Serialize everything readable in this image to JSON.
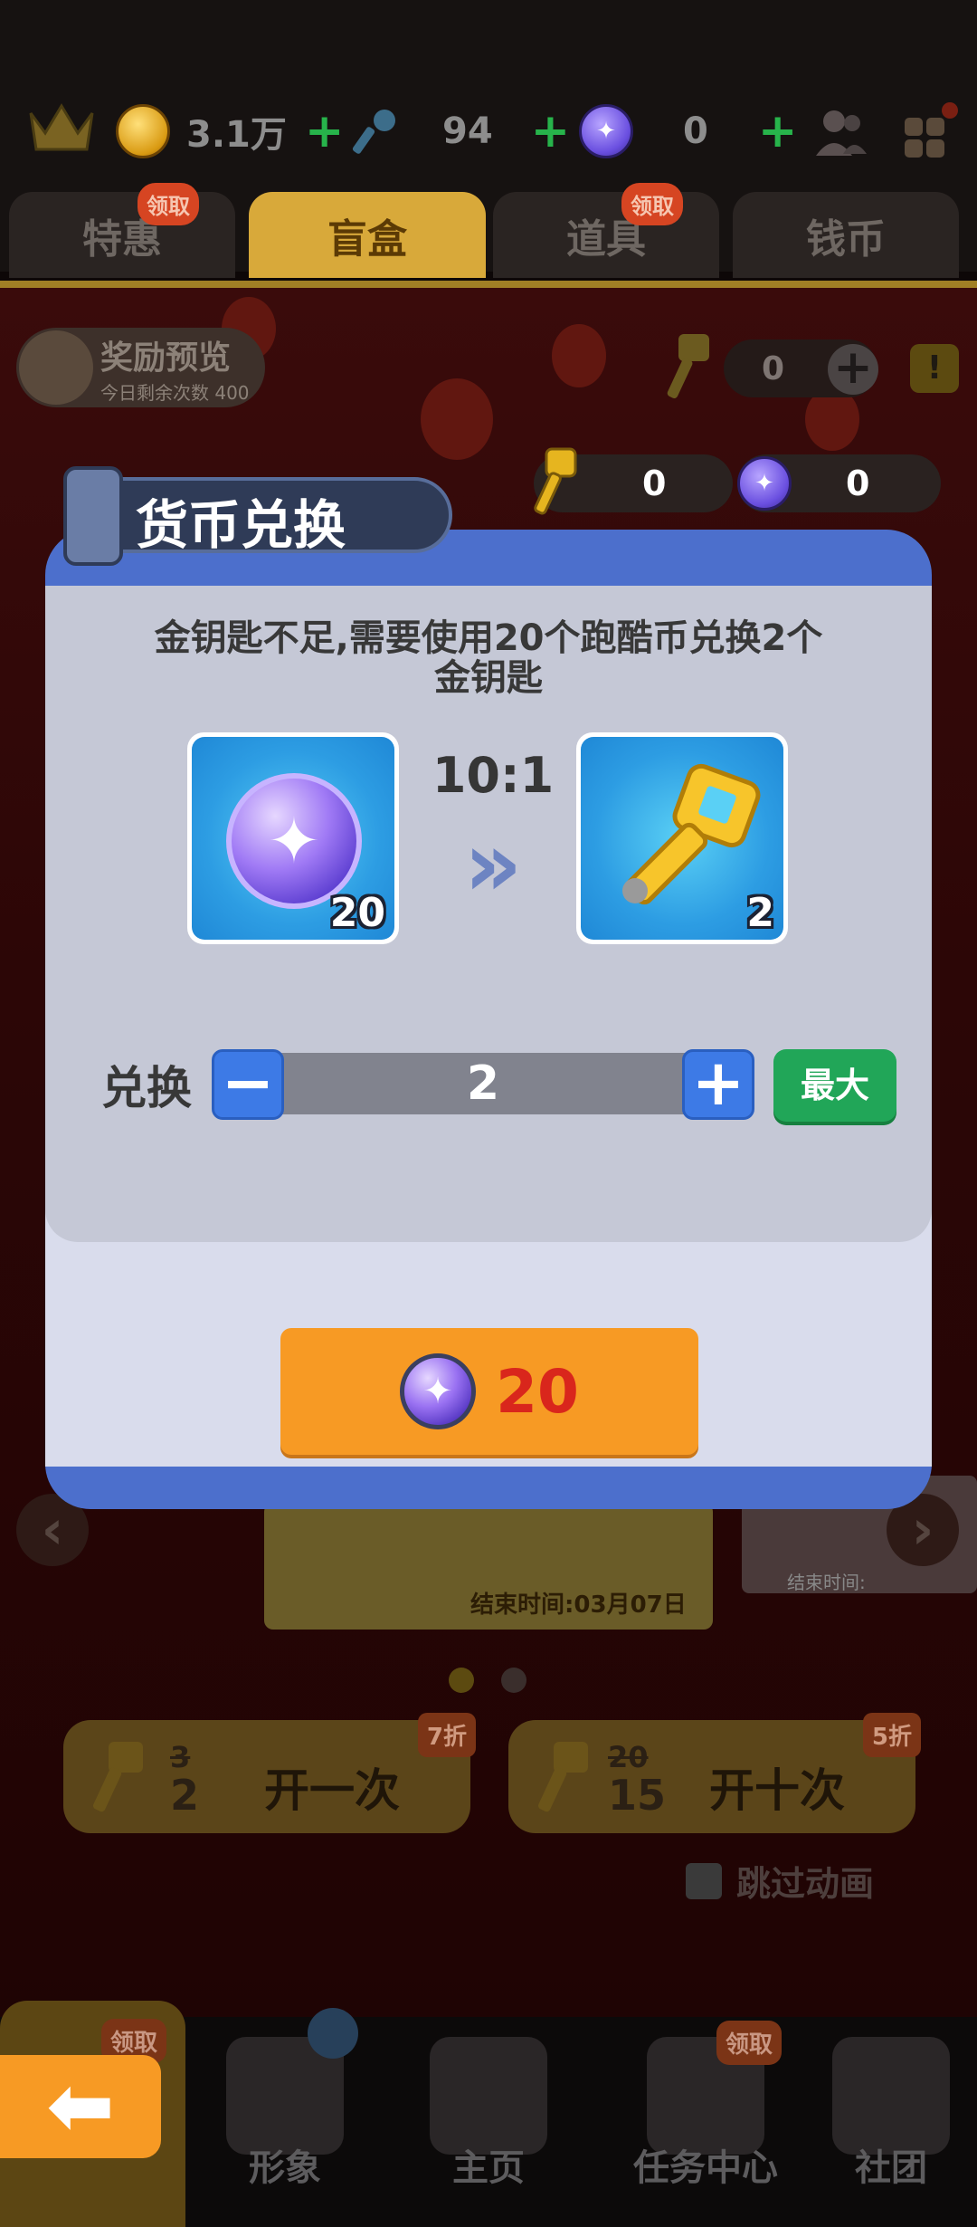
{
  "topbar": {
    "coins": "3.1万",
    "keys": "94",
    "gems": "0"
  },
  "tabs": [
    {
      "label": "特惠",
      "badge": "领取"
    },
    {
      "label": "盲盒",
      "badge": ""
    },
    {
      "label": "道具",
      "badge": "领取"
    },
    {
      "label": "钱币",
      "badge": ""
    }
  ],
  "scene": {
    "preview_title": "奖励预览",
    "preview_sub": "今日剩余次数 400",
    "right_key_count": "0",
    "help_label": "!",
    "counts": {
      "keys": "0",
      "gems": "0"
    }
  },
  "dialog": {
    "title": "货币兑换",
    "message": "金钥匙不足,需要使用20个跑酷币兑换2个金钥匙",
    "from_amount": "20",
    "to_amount": "2",
    "ratio": "10:1",
    "exchange_label": "兑换",
    "quantity": "2",
    "minus": "−",
    "plus": "+",
    "max_label": "最大",
    "cost": "20"
  },
  "lower": {
    "event_end": "结束时间:03月07日",
    "event_end2": "结束时间:",
    "open_once": {
      "old": "3",
      "new": "2",
      "label": "开一次",
      "badge": "7折"
    },
    "open_ten": {
      "old": "20",
      "new": "15",
      "label": "开十次",
      "badge": "5折"
    },
    "skip_label": "跳过动画"
  },
  "bottom_nav": [
    {
      "label": "",
      "badge": "领取"
    },
    {
      "label": "形象",
      "badge": ""
    },
    {
      "label": "主页",
      "badge": ""
    },
    {
      "label": "任务中心",
      "badge": "领取"
    },
    {
      "label": "社团",
      "badge": ""
    }
  ],
  "colors": {
    "dialog_blue": "#4c6fcc",
    "confirm_orange": "#f79a24",
    "max_green": "#21a658",
    "cost_red": "#d9261c"
  }
}
